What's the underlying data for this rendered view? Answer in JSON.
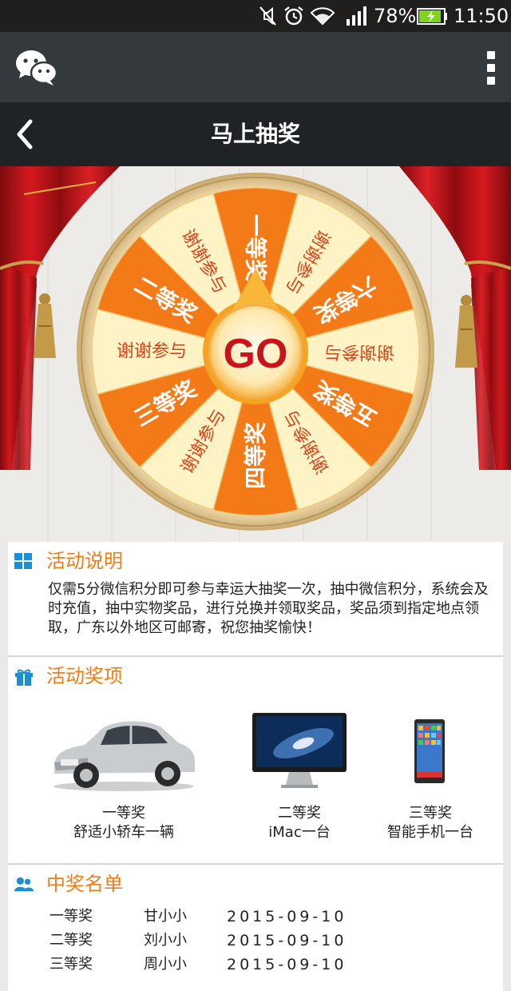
{
  "status_bar": {
    "battery": "78%",
    "time": "11:50",
    "icons": [
      "mute-icon",
      "alarm-icon",
      "wifi-icon",
      "signal-icon",
      "battery-charging-icon"
    ]
  },
  "app_bar": {
    "logo_icon": "wechat-icon",
    "menu_icon": "more-vertical-icon"
  },
  "title_bar": {
    "back_icon": "back-chevron-icon",
    "title": "马上抽奖"
  },
  "wheel": {
    "center_label": "GO",
    "segments": [
      "一等奖",
      "谢谢参与",
      "六等奖",
      "谢谢参与",
      "五等奖",
      "谢谢参与",
      "四等奖",
      "谢谢参与",
      "三等奖",
      "谢谢参与",
      "二等奖",
      "谢谢参与"
    ]
  },
  "sections": {
    "description": {
      "title": "活动说明",
      "icon": "grid-icon",
      "text": "仅需5分微信积分即可参与幸运大抽奖一次，抽中微信积分，系统会及时充值，抽中实物奖品，进行兑换并领取奖品，奖品须到指定地点领取，广东以外地区可邮寄，祝您抽奖愉快！"
    },
    "prizes": {
      "title": "活动奖项",
      "icon": "gift-icon",
      "items": [
        {
          "level": "一等奖",
          "name": "舒适小轿车一辆",
          "image": "car-image"
        },
        {
          "level": "二等奖",
          "name": "iMac一台",
          "image": "imac-image"
        },
        {
          "level": "三等奖",
          "name": "智能手机一台",
          "image": "smartphone-image"
        }
      ]
    },
    "winners": {
      "title": "中奖名单",
      "icon": "users-icon",
      "rows": [
        {
          "level": "一等奖",
          "name": "甘小小",
          "date": "2015-09-10"
        },
        {
          "level": "二等奖",
          "name": "刘小小",
          "date": "2015-09-10"
        },
        {
          "level": "三等奖",
          "name": "周小小",
          "date": "2015-09-10"
        }
      ]
    }
  },
  "colors": {
    "accent": "#ee7d14",
    "segment_orange": "#f47a18",
    "segment_cream": "#fdf3c4",
    "wheel_rim": "#e9d3a4",
    "curtain_red": "#c1141a",
    "app_bar": "#34393d",
    "title_bar": "#1f2326"
  }
}
